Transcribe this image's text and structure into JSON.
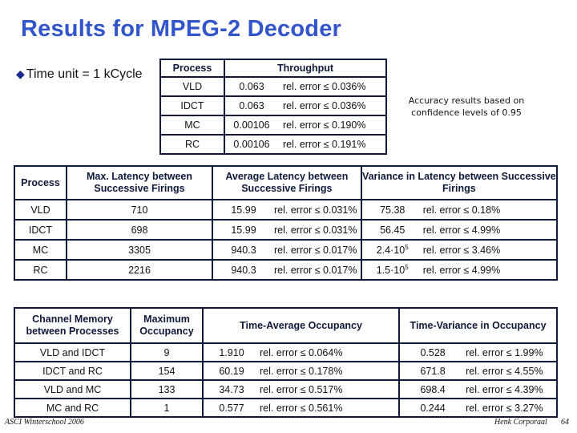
{
  "title": "Results for MPEG-2 Decoder",
  "bullet": {
    "icon": "diamond-bullet-icon",
    "text": "Time unit = 1 kCycle"
  },
  "note": "Accuracy results based on confidence levels of 0.95",
  "throughput_table": {
    "headers": [
      "Process",
      "Throughput"
    ],
    "rows": [
      {
        "process": "VLD",
        "value": "0.063",
        "error": "rel. error ≤ 0.036%"
      },
      {
        "process": "IDCT",
        "value": "0.063",
        "error": "rel. error ≤ 0.036%"
      },
      {
        "process": "MC",
        "value": "0.00106",
        "error": "rel. error ≤ 0.190%"
      },
      {
        "process": "RC",
        "value": "0.00106",
        "error": "rel. error ≤ 0.191%"
      }
    ]
  },
  "latency_table": {
    "headers": [
      "Process",
      "Max. Latency between Successive Firings",
      "Average Latency between Successive Firings",
      "Variance in Latency between Successive Firings"
    ],
    "rows": [
      {
        "process": "VLD",
        "max": "710",
        "avg": "15.99",
        "avg_error": "rel. error ≤ 0.031%",
        "var_base": "75.38",
        "var_exp": "",
        "var_error": "rel. error ≤ 0.18%"
      },
      {
        "process": "IDCT",
        "max": "698",
        "avg": "15.99",
        "avg_error": "rel. error ≤ 0.031%",
        "var_base": "56.45",
        "var_exp": "",
        "var_error": "rel. error ≤ 4.99%"
      },
      {
        "process": "MC",
        "max": "3305",
        "avg": "940.3",
        "avg_error": "rel. error ≤ 0.017%",
        "var_base": "2.4·10",
        "var_exp": "5",
        "var_error": "rel. error ≤ 3.46%"
      },
      {
        "process": "RC",
        "max": "2216",
        "avg": "940.3",
        "avg_error": "rel. error ≤ 0.017%",
        "var_base": "1.5·10",
        "var_exp": "5",
        "var_error": "rel. error ≤ 4.99%"
      }
    ]
  },
  "occupancy_table": {
    "headers": [
      "Channel Memory between Processes",
      "Maximum Occupancy",
      "Time-Average Occupancy",
      "Time-Variance in Occupancy"
    ],
    "rows": [
      {
        "channel": "VLD and IDCT",
        "max": "9",
        "avg": "1.910",
        "avg_error": "rel. error ≤ 0.064%",
        "var": "0.528",
        "var_error": "rel. error ≤ 1.99%"
      },
      {
        "channel": "IDCT and RC",
        "max": "154",
        "avg": "60.19",
        "avg_error": "rel. error ≤ 0.178%",
        "var": "671.8",
        "var_error": "rel. error ≤ 4.55%"
      },
      {
        "channel": "VLD and MC",
        "max": "133",
        "avg": "34.73",
        "avg_error": "rel. error ≤ 0.517%",
        "var": "698.4",
        "var_error": "rel. error ≤ 4.39%"
      },
      {
        "channel": "MC and RC",
        "max": "1",
        "avg": "0.577",
        "avg_error": "rel. error ≤ 0.561%",
        "var": "0.244",
        "var_error": "rel. error ≤ 3.27%"
      }
    ]
  },
  "footer": {
    "left": "ASCI Winterschool 2006",
    "author": "Henk Corporaal",
    "page": "64"
  }
}
